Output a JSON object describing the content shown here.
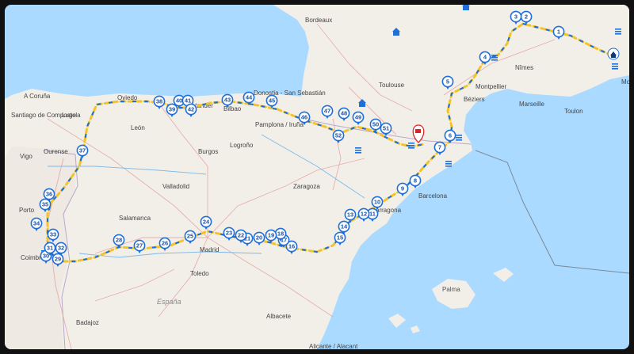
{
  "map": {
    "cities": [
      "Bordeaux",
      "Toulouse",
      "Montpellier",
      "Nîmes",
      "Marseille",
      "Toulon",
      "Mo",
      "Béziers",
      "A Coruña",
      "Santiago de Compostela",
      "Lugo",
      "Oviedo",
      "Santander",
      "Bilbao",
      "Donostia - San Sebastián",
      "Pamplona / Iruña",
      "Logroño",
      "Burgos",
      "León",
      "Ourense",
      "Vigo",
      "Valladolid",
      "Zaragoza",
      "Salamanca",
      "Porto",
      "Coimbra",
      "Madrid",
      "Toledo",
      "Tarragona",
      "Barcelona",
      "Palma",
      "Badajoz",
      "Albacete",
      "Alicante / Alacant"
    ],
    "country_label": "España",
    "route_color": "#f2c42c",
    "pin_color": "#1e6fd9",
    "water_color": "#aadaff",
    "land_color": "#f2efe9",
    "stages": [
      "1",
      "2",
      "3",
      "4",
      "5",
      "6",
      "7",
      "8",
      "9",
      "10",
      "11",
      "12",
      "13",
      "14",
      "15",
      "16",
      "17",
      "18",
      "19",
      "20",
      "21",
      "22",
      "23",
      "24",
      "25",
      "26",
      "27",
      "28",
      "29",
      "30",
      "31",
      "32",
      "33",
      "34",
      "35",
      "36",
      "37",
      "38",
      "39",
      "40",
      "41",
      "42",
      "43",
      "44",
      "45",
      "46",
      "47",
      "48",
      "49",
      "50",
      "51",
      "52"
    ],
    "icons": [
      "home-icon",
      "hotel-icon",
      "finish-flag-icon"
    ]
  }
}
